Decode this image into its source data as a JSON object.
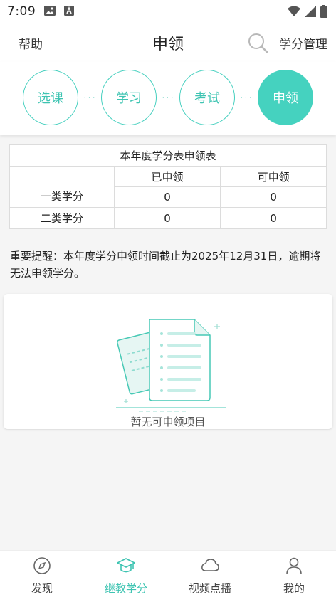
{
  "status_bar": {
    "time": "7:09"
  },
  "header": {
    "help_label": "帮助",
    "title": "申领",
    "credit_mgmt_label": "学分管理"
  },
  "steps": [
    {
      "label": "选课",
      "active": false
    },
    {
      "label": "学习",
      "active": false
    },
    {
      "label": "考试",
      "active": false
    },
    {
      "label": "申领",
      "active": true
    }
  ],
  "credit_table": {
    "caption": "本年度学分表申领表",
    "columns": [
      "",
      "已申领",
      "可申领"
    ],
    "rows": [
      {
        "label": "一类学分",
        "claimed": "0",
        "claimable": "0"
      },
      {
        "label": "二类学分",
        "claimed": "0",
        "claimable": "0"
      }
    ]
  },
  "reminder": "重要提醒：本年度学分申领时间截止为2025年12月31日，逾期将无法申领学分。",
  "empty_state": {
    "text": "暂无可申领项目"
  },
  "tab_bar": [
    {
      "label": "发现",
      "icon": "compass-icon",
      "active": false
    },
    {
      "label": "继教学分",
      "icon": "graduation-cap-icon",
      "active": true
    },
    {
      "label": "视频点播",
      "icon": "cloud-icon",
      "active": false
    },
    {
      "label": "我的",
      "icon": "person-icon",
      "active": false
    }
  ],
  "colors": {
    "accent": "#45d2bf",
    "accent_text": "#3ec4b2",
    "background": "#f5f5f5"
  }
}
